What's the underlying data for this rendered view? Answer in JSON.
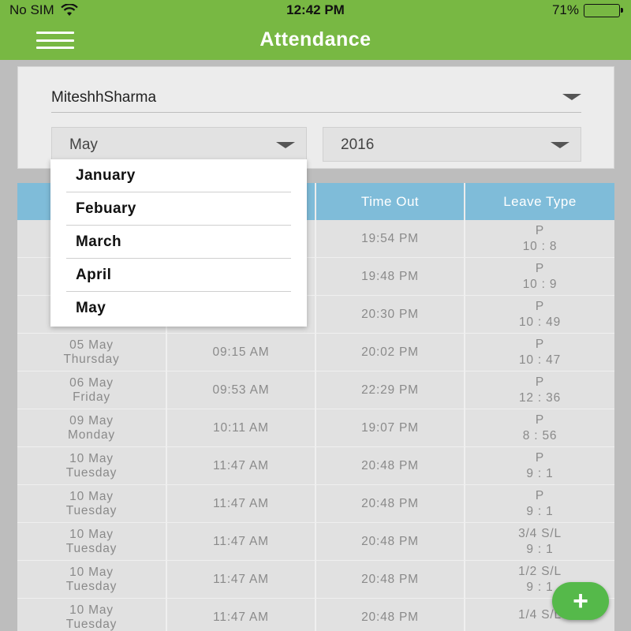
{
  "status_bar": {
    "carrier": "No SIM",
    "time": "12:42 PM",
    "battery": "71%",
    "battery_level": 0.71
  },
  "header": {
    "title": "Attendance",
    "menu_icon": "hamburger-icon"
  },
  "filters": {
    "employee": "MiteshhSharma",
    "month": "May",
    "year": "2016"
  },
  "month_dropdown": {
    "options": [
      "January",
      "Febuary",
      "March",
      "April",
      "May"
    ]
  },
  "table": {
    "headers": [
      "Time Out",
      "Leave Type"
    ],
    "rows": [
      {
        "date": "",
        "day": "",
        "time_in": "",
        "time_out": "19:54 PM",
        "leave_type": "P",
        "hours": "10 : 8"
      },
      {
        "date": "",
        "day": "",
        "time_in": "",
        "time_out": "19:48 PM",
        "leave_type": "P",
        "hours": "10 : 9"
      },
      {
        "date": "",
        "day": "",
        "time_in": "",
        "time_out": "20:30 PM",
        "leave_type": "P",
        "hours": "10 : 49"
      },
      {
        "date": "05 May",
        "day": "Thursday",
        "time_in": "09:15 AM",
        "time_out": "20:02 PM",
        "leave_type": "P",
        "hours": "10 : 47"
      },
      {
        "date": "06 May",
        "day": "Friday",
        "time_in": "09:53 AM",
        "time_out": "22:29 PM",
        "leave_type": "P",
        "hours": "12 : 36"
      },
      {
        "date": "09 May",
        "day": "Monday",
        "time_in": "10:11 AM",
        "time_out": "19:07 PM",
        "leave_type": "P",
        "hours": "8 : 56"
      },
      {
        "date": "10 May",
        "day": "Tuesday",
        "time_in": "11:47 AM",
        "time_out": "20:48 PM",
        "leave_type": "P",
        "hours": "9 : 1"
      },
      {
        "date": "10 May",
        "day": "Tuesday",
        "time_in": "11:47 AM",
        "time_out": "20:48 PM",
        "leave_type": "P",
        "hours": "9 : 1"
      },
      {
        "date": "10 May",
        "day": "Tuesday",
        "time_in": "11:47 AM",
        "time_out": "20:48 PM",
        "leave_type": "3/4 S/L",
        "hours": "9 : 1"
      },
      {
        "date": "10 May",
        "day": "Tuesday",
        "time_in": "11:47 AM",
        "time_out": "20:48 PM",
        "leave_type": "1/2 S/L",
        "hours": "9 : 1"
      },
      {
        "date": "10 May",
        "day": "Tuesday",
        "time_in": "11:47 AM",
        "time_out": "20:48 PM",
        "leave_type": "1/4 S/L",
        "hours": ""
      }
    ]
  },
  "fab": {
    "label": "+",
    "icon": "plus-icon"
  }
}
